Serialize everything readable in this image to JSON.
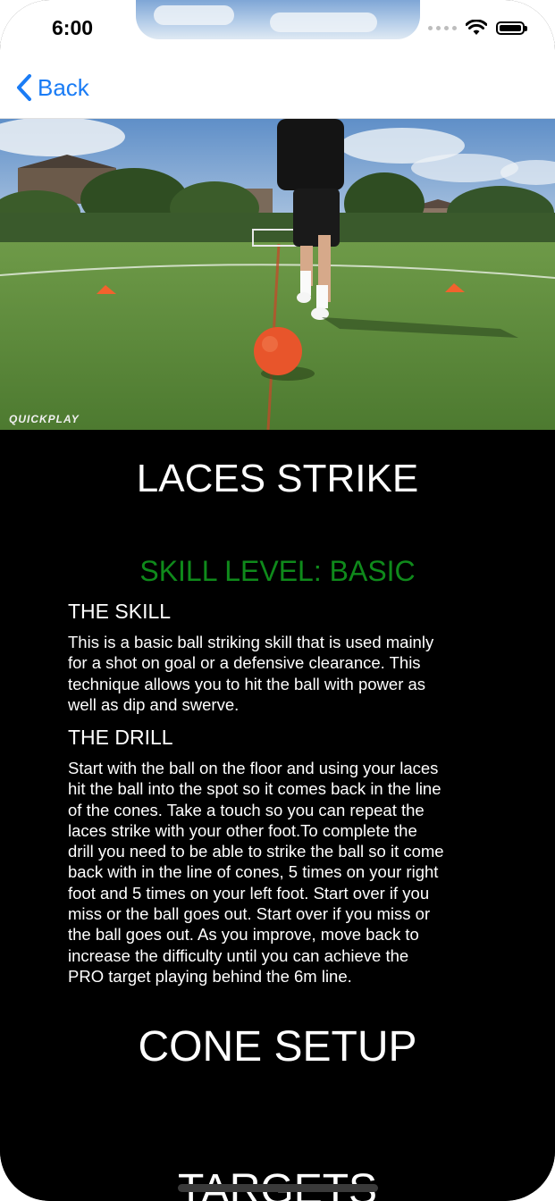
{
  "status": {
    "time": "6:00"
  },
  "nav": {
    "back_label": "Back"
  },
  "video": {
    "watermark": "QUICKPLAY"
  },
  "drill": {
    "title": "LACES STRIKE",
    "skill_level": "SKILL LEVEL: BASIC",
    "skill_heading": "THE SKILL",
    "skill_lines": [
      "This is a basic ball striking skill that is used mainly",
      "for a shot on goal or a defensive clearance. This",
      "technique allows you to hit the ball with power as",
      "well as dip and swerve."
    ],
    "drill_heading": "THE DRILL",
    "drill_lines": [
      "Start with the ball on the floor and using your laces",
      "hit the ball into the spot so it comes back in the line",
      "of the cones. Take a touch so you can repeat the",
      "laces strike with your other foot.To complete the",
      "drill you need to be able to strike the ball so it come",
      "back with in the line of cones, 5 times on your right",
      "foot and 5 times on your left foot. Start over if you",
      "miss or the ball goes out. Start over if you miss or",
      "the ball goes out. As you improve, move back to",
      "increase the difficulty until you can achieve the",
      "PRO target playing behind the 6m line."
    ],
    "cone_setup_heading": "CONE SETUP",
    "targets_heading": "TARGETS"
  },
  "colors": {
    "accent_blue": "#1a7cf5",
    "skill_green": "#0f8a1b",
    "background": "#000000"
  }
}
